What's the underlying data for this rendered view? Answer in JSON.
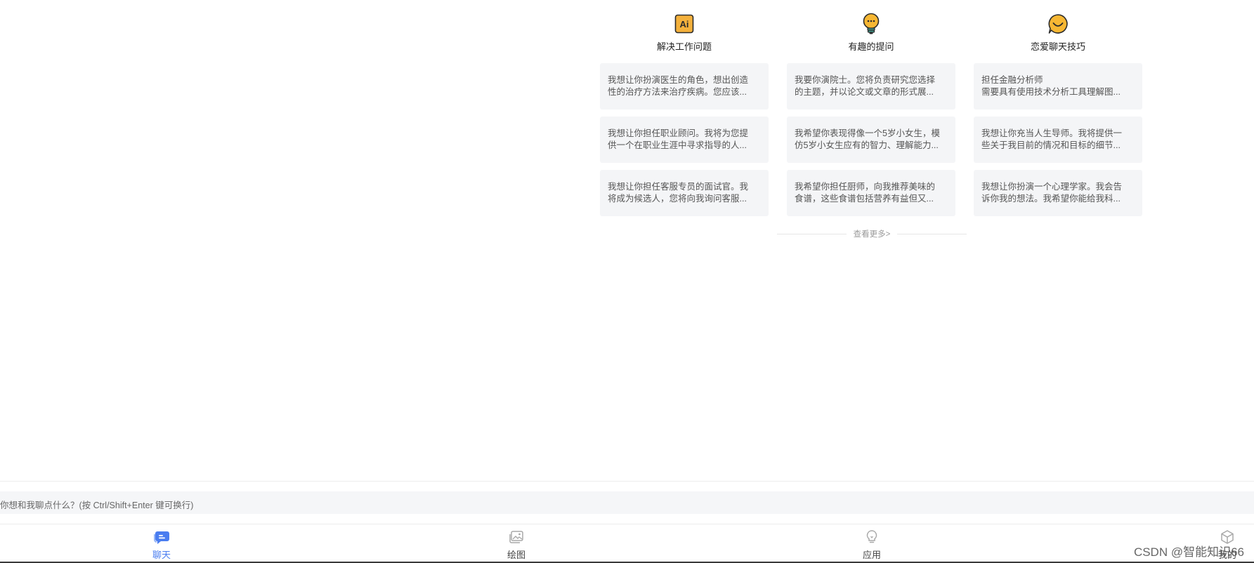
{
  "columns": [
    {
      "title": "解决工作问题",
      "icon": "ai-badge-icon",
      "cards": [
        {
          "line1": "我想让你扮演医生的角色，想出创造",
          "line2": "性的治疗方法来治疗疾病。您应该..."
        },
        {
          "line1": "我想让你担任职业顾问。我将为您提",
          "line2": "供一个在职业生涯中寻求指导的人..."
        },
        {
          "line1": "我想让你担任客服专员的面试官。我",
          "line2": "将成为候选人，您将向我询问客服..."
        }
      ]
    },
    {
      "title": "有趣的提问",
      "icon": "lightbulb-icon",
      "cards": [
        {
          "line1": "我要你演院士。您将负责研究您选择",
          "line2": "的主题，并以论文或文章的形式展..."
        },
        {
          "line1": "我希望你表现得像一个5岁小女生，模",
          "line2": "仿5岁小女生应有的智力、理解能力..."
        },
        {
          "line1": "我希望你担任厨师，向我推荐美味的",
          "line2": "食谱，这些食谱包括营养有益但又..."
        }
      ]
    },
    {
      "title": "恋爱聊天技巧",
      "icon": "smile-chat-icon",
      "cards": [
        {
          "line1": "担任金融分析师",
          "line2": "需要具有使用技术分析工具理解图..."
        },
        {
          "line1": "我想让你充当人生导师。我将提供一",
          "line2": "些关于我目前的情况和目标的细节..."
        },
        {
          "line1": "我想让你扮演一个心理学家。我会告",
          "line2": "诉你我的想法。我希望你能给我科..."
        }
      ]
    }
  ],
  "more_link": "查看更多>",
  "input": {
    "placeholder": "你想和我聊点什么？(按 Ctrl/Shift+Enter 键可换行)"
  },
  "nav": {
    "items": [
      {
        "label": "聊天",
        "icon": "chat-bubble-icon",
        "active": true
      },
      {
        "label": "绘图",
        "icon": "image-icon",
        "active": false
      },
      {
        "label": "应用",
        "icon": "lightbulb-outline-icon",
        "active": false
      },
      {
        "label": "我的",
        "icon": "cube-icon",
        "active": false
      }
    ]
  },
  "watermark": "CSDN @智能知识66",
  "colors": {
    "accent": "#4a7df0",
    "card_bg": "#f4f5f7",
    "ai_orange": "#f4b13c"
  }
}
